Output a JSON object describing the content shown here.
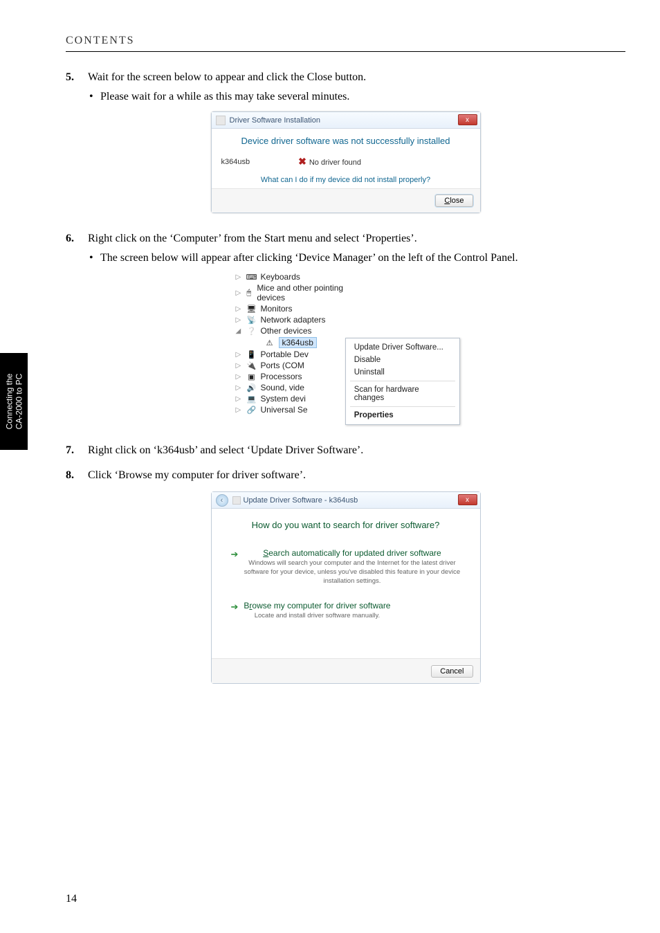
{
  "sideTab": {
    "line1": "Connecting the",
    "line2": "CA-2000 to PC"
  },
  "header": {
    "title": "CONTENTS"
  },
  "steps": {
    "s5": {
      "num": "5.",
      "text": "Wait for the screen below to appear and click the Close button.",
      "bullet": "Please wait for a while as this may take several minutes."
    },
    "s6": {
      "num": "6.",
      "text": "Right click on the ‘Computer’ from the Start menu and select ‘Properties’.",
      "bullet": "The screen below will appear after clicking ‘Device Manager’ on the left of the Control Panel."
    },
    "s7": {
      "num": "7.",
      "text": "Right click on ‘k364usb’ and select ‘Update Driver Software’."
    },
    "s8": {
      "num": "8.",
      "text": "Click ‘Browse my computer for driver software’."
    }
  },
  "dlg1": {
    "title": "Driver Software Installation",
    "closeGlyph": "x",
    "message": "Device driver software was not successfully installed",
    "device": "k364usb",
    "statusIcon": "✖",
    "status": "No driver found",
    "link": "What can I do if my device did not install properly?",
    "closeBtnPrefix": "C",
    "closeBtnRest": "lose"
  },
  "dm": {
    "nodes": {
      "keyboards": "Keyboards",
      "mice": "Mice and other pointing devices",
      "monitors": "Monitors",
      "network": "Network adapters",
      "other": "Other devices",
      "k364": "k364usb",
      "portable": "Portable Dev",
      "ports": "Ports (COM",
      "processors": "Processors",
      "sound": "Sound, vide",
      "system": "System devi",
      "usb": "Universal Se"
    },
    "menu": {
      "update": "Update Driver Software...",
      "disable": "Disable",
      "uninstall": "Uninstall",
      "scan": "Scan for hardware changes",
      "properties": "Properties"
    }
  },
  "dlg2": {
    "title": "Update Driver Software - k364usb",
    "closeGlyph": "x",
    "backGlyph": "‹",
    "question": "How do you want to search for driver software?",
    "opt1": {
      "titlePrefix": "S",
      "titleRest": "earch automatically for updated driver software",
      "desc": "Windows will search your computer and the Internet for the latest driver software for your device, unless you've disabled this feature in your device installation settings."
    },
    "opt2": {
      "titlePrefix": "B",
      "titleMid": "r",
      "titleRest": "owse my computer for driver software",
      "desc": "Locate and install driver software manually."
    },
    "cancel": "Cancel"
  },
  "pageNumber": "14"
}
